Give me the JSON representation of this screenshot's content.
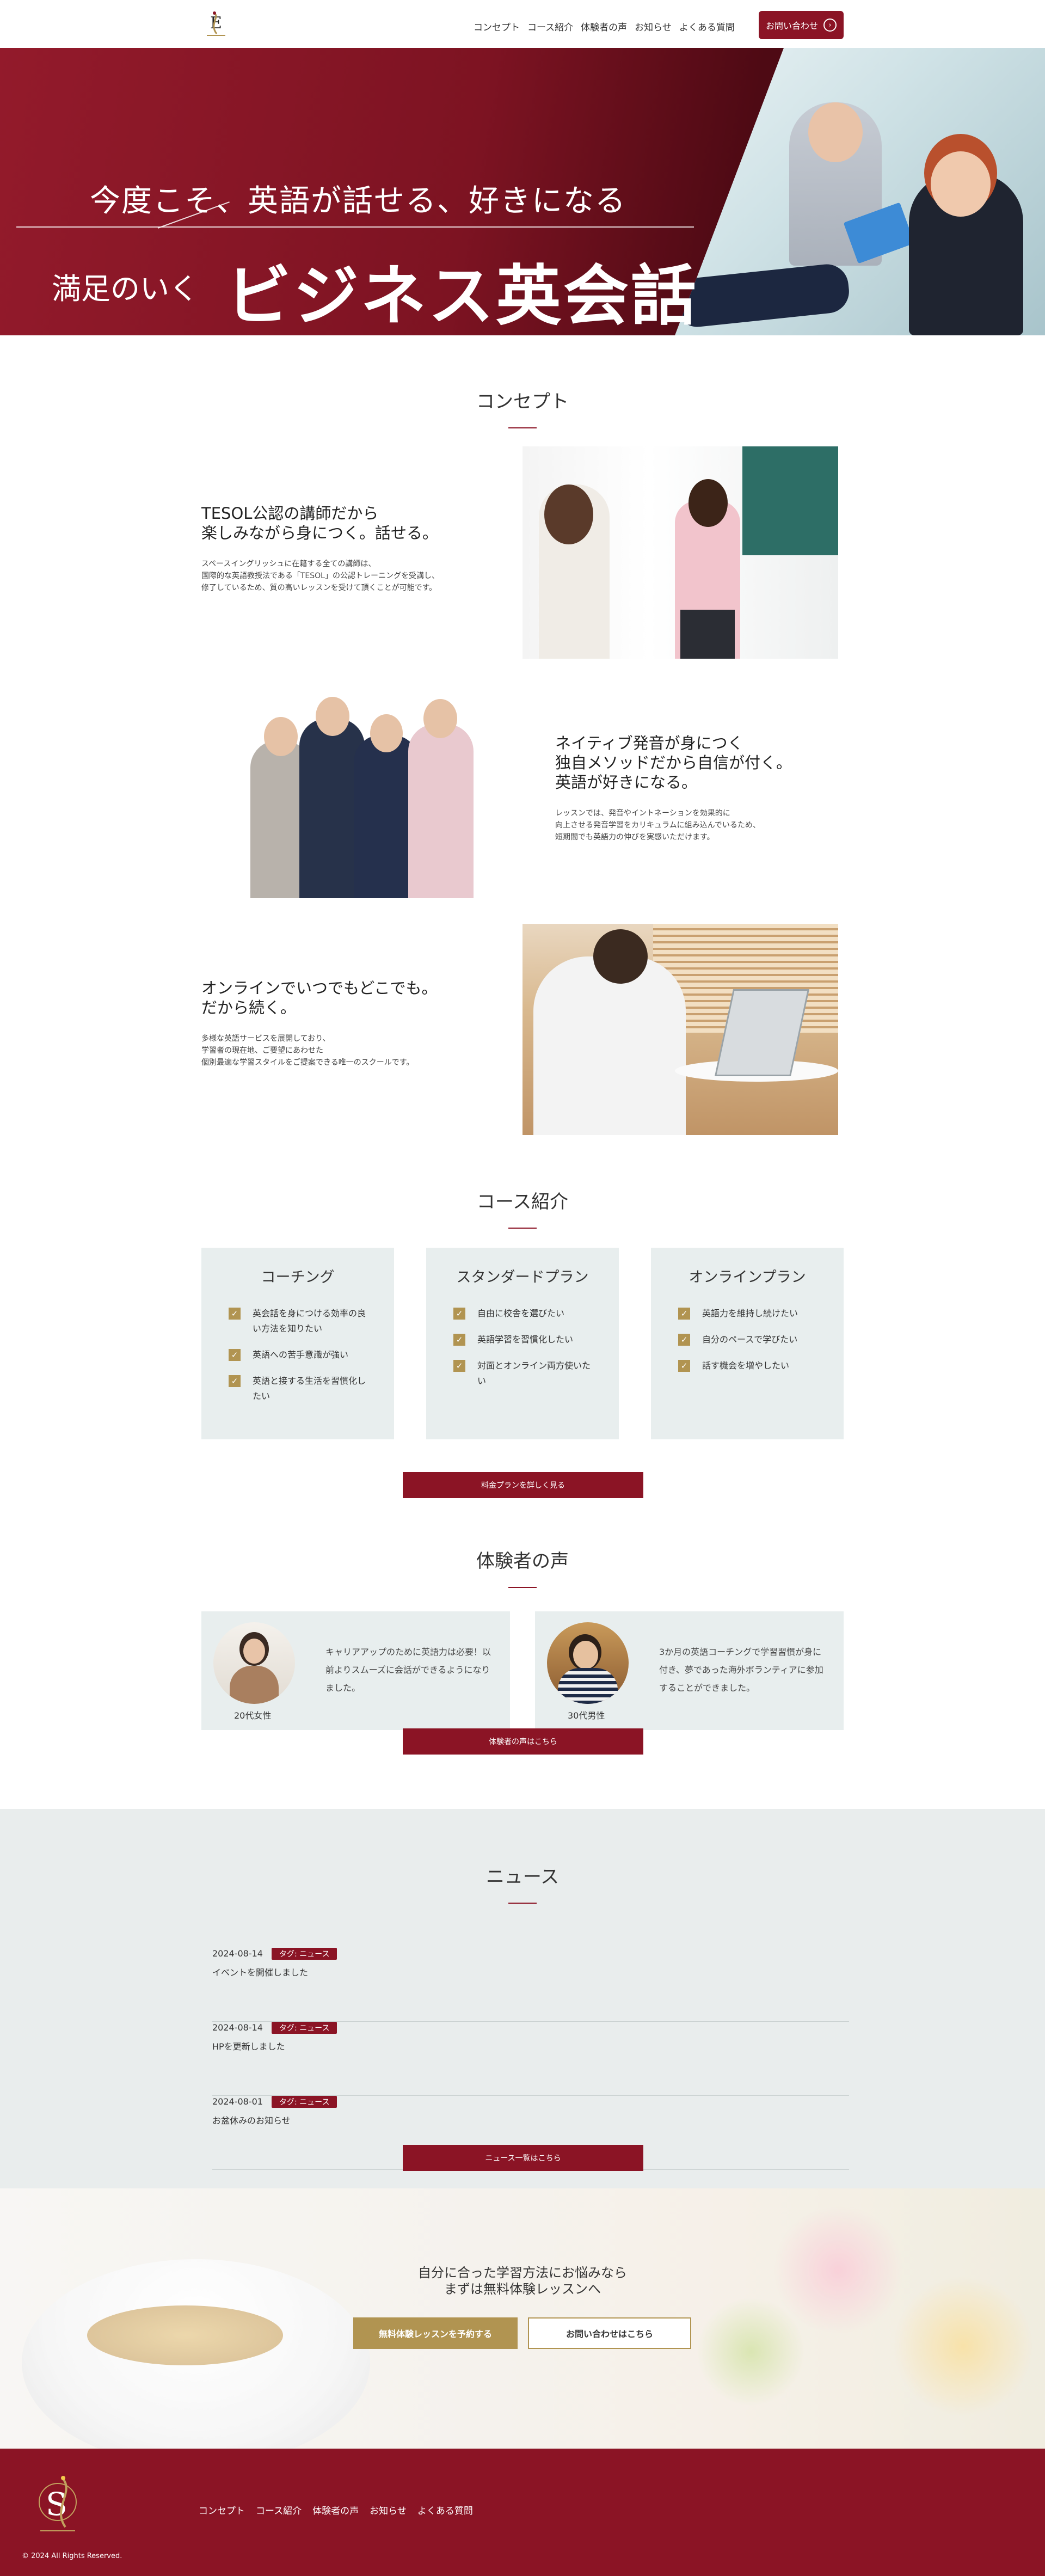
{
  "header": {
    "nav": [
      "コンセプト",
      "コース紹介",
      "体験者の声",
      "お知らせ",
      "よくある質問"
    ],
    "contact_label": "お問い合わせ"
  },
  "hero": {
    "subtitle": "今度こそ、英語が話せる、好きになる",
    "prefix": "満足のいく",
    "title": "ビジネス英会話"
  },
  "concept": {
    "title": "コンセプト",
    "items": [
      {
        "heading1": "TESOL公認の講師だから",
        "heading2": "楽しみながら身につく。話せる。",
        "text1": "スペースイングリッシュに在籍する全ての講師は、",
        "text2": "国際的な英語教授法である「TESOL」の公認トレーニングを受講し、",
        "text3": "修了しているため、質の高いレッスンを受けて頂くことが可能です。"
      },
      {
        "heading1": "ネイティブ発音が身につく",
        "heading2": "独自メソッドだから自信が付く。",
        "heading3": "英語が好きになる。",
        "text1": "レッスンでは、発音やイントネーションを効果的に",
        "text2": "向上させる発音学習をカリキュラムに組み込んでいるため、",
        "text3": "短期間でも英語力の伸びを実感いただけます。"
      },
      {
        "heading1": "オンラインでいつでもどこでも。",
        "heading2": "だから続く。",
        "text1": "多様な英語サービスを展開しており、",
        "text2": "学習者の現在地、ご要望にあわせた",
        "text3": "個別最適な学習スタイルをご提案できる唯一のスクールです。"
      }
    ]
  },
  "courses": {
    "title": "コース紹介",
    "cards": [
      {
        "name": "コーチング",
        "items": [
          "英会話を身につける効率の良い方法を知りたい",
          "英語への苦手意識が強い",
          "英語と接する生活を習慣化したい"
        ]
      },
      {
        "name": "スタンダードプラン",
        "items": [
          "自由に校舎を選びたい",
          "英語学習を習慣化したい",
          "対面とオンライン両方使いたい"
        ]
      },
      {
        "name": "オンラインプラン",
        "items": [
          "英語力を維持し続けたい",
          "自分のペースで学びたい",
          "話す機会を増やしたい"
        ]
      }
    ],
    "button": "料金プランを詳しく見る"
  },
  "voices": {
    "title": "体験者の声",
    "items": [
      {
        "meta": "20代女性",
        "text": "キャリアアップのために英語力は必要！以前よりスムーズに会話ができるようになりました。"
      },
      {
        "meta": "30代男性",
        "text": "3か月の英語コーチングで学習習慣が身に付き、夢であった海外ボランティアに参加することができました。"
      }
    ],
    "button": "体験者の声はこちら"
  },
  "news": {
    "title": "ニュース",
    "items": [
      {
        "date": "2024-08-14",
        "tag": "タグ: ニュース",
        "title": "イベントを開催しました"
      },
      {
        "date": "2024-08-14",
        "tag": "タグ: ニュース",
        "title": "HPを更新しました"
      },
      {
        "date": "2024-08-01",
        "tag": "タグ: ニュース",
        "title": "お盆休みのお知らせ"
      }
    ],
    "button": "ニュース一覧はこちら"
  },
  "cta": {
    "line1": "自分に合った学習方法にお悩みなら",
    "line2": "まずは無料体験レッスンへ",
    "primary": "無料体験レッスンを予約する",
    "secondary": "お問い合わせはこちら"
  },
  "footer": {
    "nav": [
      "コンセプト",
      "コース紹介",
      "体験者の声",
      "お知らせ",
      "よくある質問"
    ],
    "copyright": "© 2024 All Rights Reserved."
  },
  "colors": {
    "brand": "#8b1425",
    "gold": "#b19451",
    "panel": "#e8eeee"
  }
}
